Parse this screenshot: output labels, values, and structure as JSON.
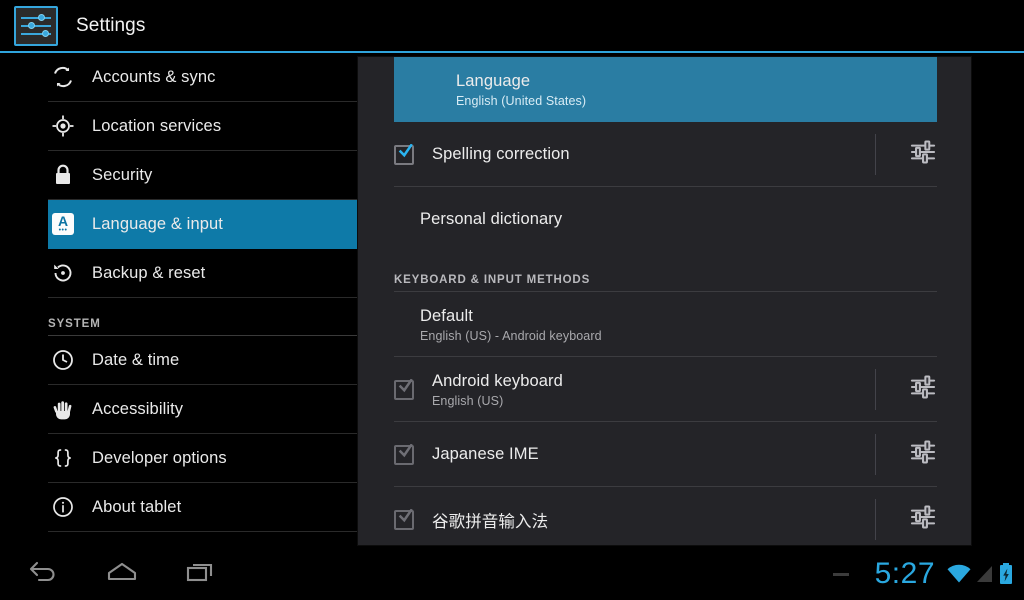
{
  "header": {
    "title": "Settings",
    "app_icon": "settings-sliders-icon",
    "accent_color": "#2fa4dc"
  },
  "sidebar": {
    "items": [
      {
        "label": "Accounts & sync",
        "icon": "sync-icon",
        "selected": false
      },
      {
        "label": "Location services",
        "icon": "location-crosshair-icon",
        "selected": false
      },
      {
        "label": "Security",
        "icon": "lock-icon",
        "selected": false
      },
      {
        "label": "Language & input",
        "icon": "language-a-icon",
        "selected": true
      },
      {
        "label": "Backup & reset",
        "icon": "backup-restore-icon",
        "selected": false
      }
    ],
    "section_label": "SYSTEM",
    "system_items": [
      {
        "label": "Date & time",
        "icon": "clock-icon"
      },
      {
        "label": "Accessibility",
        "icon": "hand-icon"
      },
      {
        "label": "Developer options",
        "icon": "braces-icon"
      },
      {
        "label": "About tablet",
        "icon": "info-circle-icon"
      }
    ],
    "selected_color": "#0e7aa8"
  },
  "main": {
    "selected_row": {
      "title": "Language",
      "subtitle": "English (United States)",
      "highlight_color": "#2a7da3"
    },
    "rows": [
      {
        "title": "Spelling correction",
        "subtitle": "",
        "checkbox": "checked",
        "checkbox_state": "enabled",
        "gear": true
      },
      {
        "title": "Personal dictionary",
        "subtitle": "",
        "checkbox": "none",
        "checkbox_state": "",
        "gear": false
      }
    ],
    "section_label": "KEYBOARD & INPUT METHODS",
    "keyboard_rows": [
      {
        "title": "Default",
        "subtitle": "English (US) - Android keyboard",
        "checkbox": "none",
        "checkbox_state": "",
        "gear": false
      },
      {
        "title": "Android keyboard",
        "subtitle": "English (US)",
        "checkbox": "checked",
        "checkbox_state": "disabled",
        "gear": true
      },
      {
        "title": "Japanese IME",
        "subtitle": "",
        "checkbox": "checked",
        "checkbox_state": "disabled",
        "gear": true
      },
      {
        "title": "谷歌拼音输入法",
        "subtitle": "",
        "checkbox": "checked",
        "checkbox_state": "disabled",
        "gear": true
      }
    ]
  },
  "navbar": {
    "back": "back-arrow-icon",
    "home": "home-icon",
    "recents": "recent-apps-icon",
    "notification_indicator": "dash-icon",
    "clock": "5:27",
    "clock_color": "#2aa8e0",
    "wifi": "wifi-icon",
    "signal": "signal-bars-icon",
    "battery": "battery-charging-icon"
  }
}
